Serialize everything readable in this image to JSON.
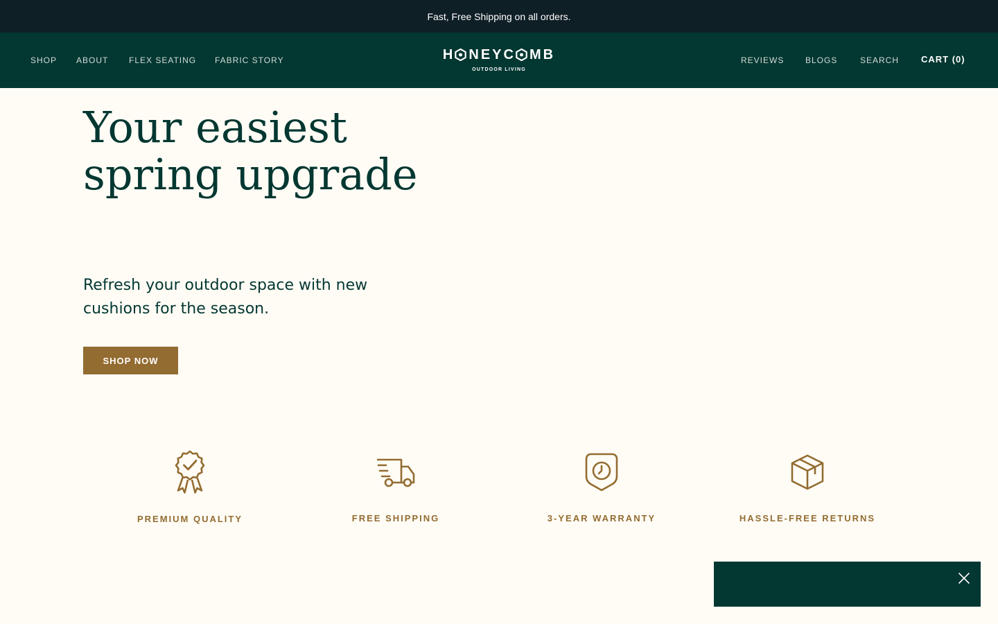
{
  "announcement": {
    "text": "Fast, Free Shipping on all orders."
  },
  "nav": {
    "left": [
      {
        "label": "SHOP"
      },
      {
        "label": "ABOUT"
      },
      {
        "label": "FLEX SEATING"
      },
      {
        "label": "FABRIC STORY"
      }
    ],
    "right": [
      {
        "label": "REVIEWS"
      },
      {
        "label": "BLOGS"
      },
      {
        "label": "SEARCH"
      },
      {
        "label": "CART (0)"
      }
    ]
  },
  "logo": {
    "main_before": "H",
    "main_after": "NEYC",
    "main_mid": "MB",
    "sub": "OUTDOOR LIVING"
  },
  "hero": {
    "title": "Your easiest spring upgrade",
    "subtitle": "Refresh your outdoor space with new cushions for the season.",
    "cta": "SHOP NOW"
  },
  "features": [
    {
      "label": "PREMIUM QUALITY",
      "icon": "ribbon-award-icon"
    },
    {
      "label": "FREE SHIPPING",
      "icon": "delivery-truck-icon"
    },
    {
      "label": "3-YEAR WARRANTY",
      "icon": "shield-clock-icon"
    },
    {
      "label": "HASSLE-FREE RETURNS",
      "icon": "package-box-icon"
    }
  ],
  "colors": {
    "header": "#033731",
    "announcement": "#0f1f26",
    "accent": "#936c31",
    "background": "#fffcf5"
  }
}
